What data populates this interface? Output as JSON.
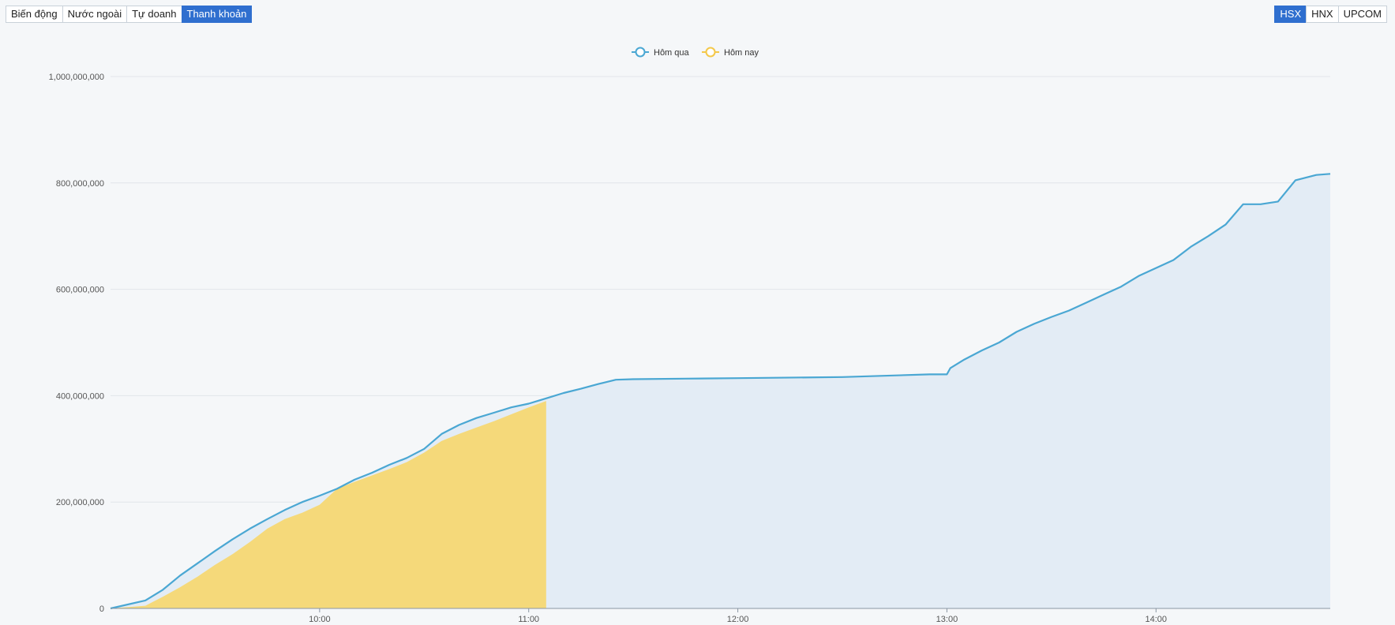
{
  "left_tabs": [
    {
      "label": "Biến động",
      "active": false
    },
    {
      "label": "Nước ngoài",
      "active": false
    },
    {
      "label": "Tự doanh",
      "active": false
    },
    {
      "label": "Thanh khoản",
      "active": true
    }
  ],
  "right_tabs": [
    {
      "label": "HSX",
      "active": true
    },
    {
      "label": "HNX",
      "active": false
    },
    {
      "label": "UPCOM",
      "active": false
    }
  ],
  "colors": {
    "accent": "#2f6fcf",
    "yesterday_line": "#4aa7d3",
    "yesterday_fill": "#e3ecf5",
    "today": "#f5d97a",
    "today_legend": "#f4c84a"
  },
  "chart_data": {
    "type": "area",
    "legend_position": "top-center",
    "grid": true,
    "xlim": [
      "09:00",
      "14:50"
    ],
    "ylim": [
      0,
      1000000000
    ],
    "x_ticks": [
      "10:00",
      "11:00",
      "12:00",
      "13:00",
      "14:00"
    ],
    "y_ticks": [
      0,
      200000000,
      400000000,
      600000000,
      800000000,
      1000000000
    ],
    "y_tick_labels": [
      "0",
      "200,000,000",
      "400,000,000",
      "600,000,000",
      "800,000,000",
      "1,000,000,000"
    ],
    "series": [
      {
        "name": "Hôm qua",
        "x": [
          "09:00",
          "09:10",
          "09:15",
          "09:20",
          "09:25",
          "09:30",
          "09:35",
          "09:40",
          "09:45",
          "09:50",
          "09:55",
          "10:00",
          "10:05",
          "10:10",
          "10:15",
          "10:20",
          "10:25",
          "10:30",
          "10:35",
          "10:40",
          "10:45",
          "10:50",
          "10:55",
          "11:00",
          "11:05",
          "11:10",
          "11:15",
          "11:20",
          "11:25",
          "11:30",
          "11:45",
          "12:00",
          "12:30",
          "12:55",
          "13:00",
          "13:01",
          "13:05",
          "13:10",
          "13:15",
          "13:20",
          "13:25",
          "13:30",
          "13:35",
          "13:40",
          "13:45",
          "13:50",
          "13:55",
          "14:00",
          "14:05",
          "14:10",
          "14:15",
          "14:20",
          "14:25",
          "14:30",
          "14:35",
          "14:40",
          "14:43",
          "14:46",
          "14:50"
        ],
        "values": [
          0,
          15000000,
          35000000,
          62000000,
          85000000,
          108000000,
          130000000,
          150000000,
          168000000,
          185000000,
          200000000,
          212000000,
          225000000,
          242000000,
          255000000,
          270000000,
          283000000,
          300000000,
          328000000,
          345000000,
          358000000,
          368000000,
          378000000,
          385000000,
          395000000,
          405000000,
          413000000,
          422000000,
          430000000,
          431000000,
          432000000,
          433000000,
          435000000,
          440000000,
          440000000,
          452000000,
          468000000,
          485000000,
          500000000,
          520000000,
          535000000,
          548000000,
          560000000,
          575000000,
          590000000,
          605000000,
          625000000,
          640000000,
          655000000,
          680000000,
          700000000,
          722000000,
          760000000,
          760000000,
          765000000,
          805000000,
          810000000,
          815000000,
          817000000
        ]
      },
      {
        "name": "Hôm nay",
        "x": [
          "09:00",
          "09:10",
          "09:15",
          "09:20",
          "09:25",
          "09:30",
          "09:35",
          "09:40",
          "09:45",
          "09:50",
          "09:55",
          "10:00",
          "10:05",
          "10:10",
          "10:15",
          "10:20",
          "10:25",
          "10:30",
          "10:35",
          "10:40",
          "10:45",
          "10:50",
          "10:55",
          "11:00",
          "11:05"
        ],
        "values": [
          0,
          5000000,
          22000000,
          40000000,
          60000000,
          82000000,
          102000000,
          125000000,
          150000000,
          168000000,
          180000000,
          195000000,
          225000000,
          238000000,
          250000000,
          262000000,
          275000000,
          293000000,
          315000000,
          328000000,
          340000000,
          352000000,
          365000000,
          378000000,
          390000000
        ]
      }
    ]
  }
}
